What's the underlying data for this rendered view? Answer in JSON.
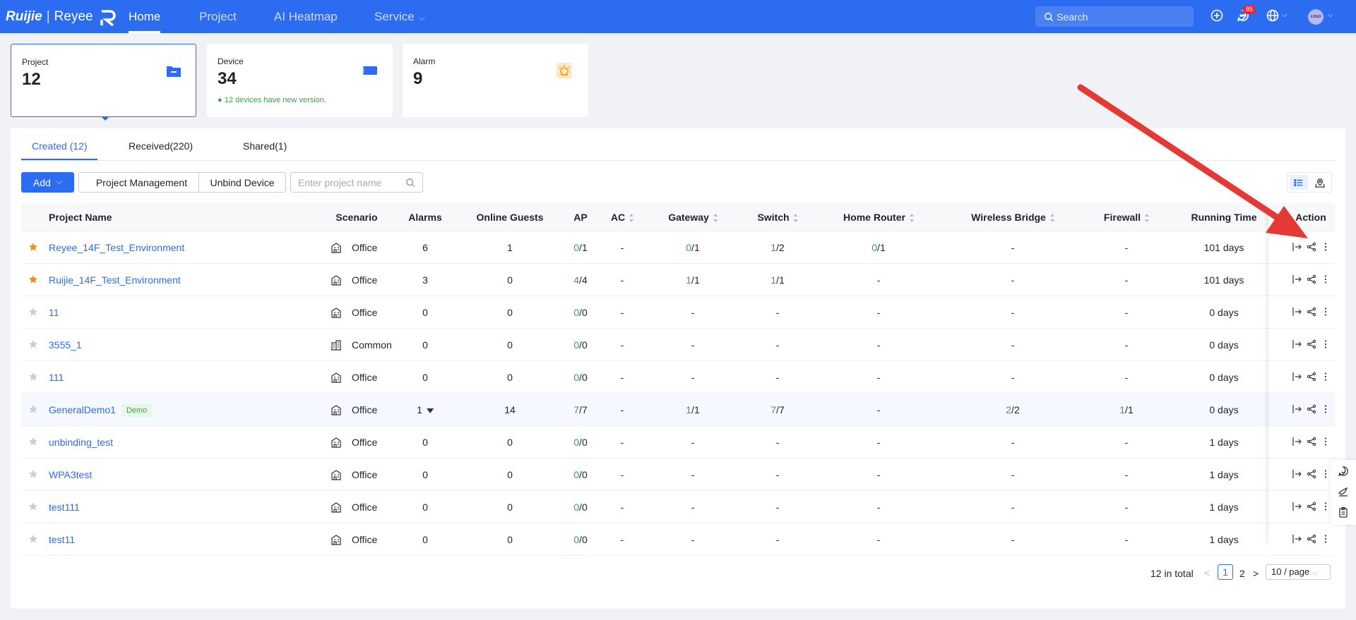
{
  "brand": {
    "name": "Ruijie",
    "sub": "Reyee"
  },
  "nav": {
    "home": "Home",
    "project": "Project",
    "heatmap": "AI Heatmap",
    "service": "Service"
  },
  "search_placeholder": "Search",
  "notifications": {
    "count": "85"
  },
  "avatar": {
    "text": "LOGO"
  },
  "cards": {
    "project": {
      "label": "Project",
      "value": "12"
    },
    "device": {
      "label": "Device",
      "value": "34",
      "note": "12 devices have new version."
    },
    "alarm": {
      "label": "Alarm",
      "value": "9"
    }
  },
  "tabs": {
    "created": "Created (12)",
    "received": "Received(220)",
    "shared": "Shared(1)"
  },
  "toolbar": {
    "add": "Add",
    "project_management": "Project Management",
    "unbind": "Unbind Device",
    "search_placeholder": "Enter project name"
  },
  "columns": {
    "name": "Project Name",
    "scenario": "Scenario",
    "alarms": "Alarms",
    "guests": "Online Guests",
    "ap": "AP",
    "ac": "AC",
    "gateway": "Gateway",
    "switch": "Switch",
    "home_router": "Home Router",
    "bridge": "Wireless Bridge",
    "firewall": "Firewall",
    "running": "Running Time",
    "action": "Action"
  },
  "rows": [
    {
      "name": "Reyee_14F_Test_Environment",
      "starred": true,
      "demo": "",
      "scenario": "Office",
      "alarms": "6",
      "guests": "1",
      "ap_on": "0",
      "ap_tot": "/1",
      "ac": "-",
      "gw_on": "0",
      "gw_tot": "/1",
      "sw_on": "1",
      "sw_tot": "/2",
      "hr_on": "0",
      "hr_tot": "/1",
      "br_on": "",
      "br_tot": "-",
      "fw_on": "",
      "fw_tot": "-",
      "running": "101 days"
    },
    {
      "name": "Ruijie_14F_Test_Environment",
      "starred": true,
      "demo": "",
      "scenario": "Office",
      "alarms": "3",
      "guests": "0",
      "ap_on": "4",
      "ap_tot": "/4",
      "ac": "-",
      "gw_on": "1",
      "gw_tot": "/1",
      "sw_on": "1",
      "sw_tot": "/1",
      "hr_on": "",
      "hr_tot": "-",
      "br_on": "",
      "br_tot": "-",
      "fw_on": "",
      "fw_tot": "-",
      "running": "101 days"
    },
    {
      "name": "11",
      "starred": false,
      "demo": "",
      "scenario": "Office",
      "alarms": "0",
      "guests": "0",
      "ap_on": "0",
      "ap_tot": "/0",
      "ac": "-",
      "gw_on": "",
      "gw_tot": "-",
      "sw_on": "",
      "sw_tot": "-",
      "hr_on": "",
      "hr_tot": "-",
      "br_on": "",
      "br_tot": "-",
      "fw_on": "",
      "fw_tot": "-",
      "running": "0 days"
    },
    {
      "name": "3555_1",
      "starred": false,
      "demo": "",
      "scenario": "Common",
      "alarms": "0",
      "guests": "0",
      "ap_on": "0",
      "ap_tot": "/0",
      "ac": "-",
      "gw_on": "",
      "gw_tot": "-",
      "sw_on": "",
      "sw_tot": "-",
      "hr_on": "",
      "hr_tot": "-",
      "br_on": "",
      "br_tot": "-",
      "fw_on": "",
      "fw_tot": "-",
      "running": "0 days"
    },
    {
      "name": "111",
      "starred": false,
      "demo": "",
      "scenario": "Office",
      "alarms": "0",
      "guests": "0",
      "ap_on": "0",
      "ap_tot": "/0",
      "ac": "-",
      "gw_on": "",
      "gw_tot": "-",
      "sw_on": "",
      "sw_tot": "-",
      "hr_on": "",
      "hr_tot": "-",
      "br_on": "",
      "br_tot": "-",
      "fw_on": "",
      "fw_tot": "-",
      "running": "0 days"
    },
    {
      "name": "GeneralDemo1",
      "starred": false,
      "demo": "Demo",
      "scenario": "Office",
      "alarms": "1",
      "guests": "14",
      "ap_on": "7",
      "ap_tot": "/7",
      "ac": "-",
      "gw_on": "1",
      "gw_tot": "/1",
      "sw_on": "7",
      "sw_tot": "/7",
      "hr_on": "",
      "hr_tot": "-",
      "br_on": "2",
      "br_tot": "/2",
      "fw_on": "1",
      "fw_tot": "/1",
      "running": "0 days"
    },
    {
      "name": "unbinding_test",
      "starred": false,
      "demo": "",
      "scenario": "Office",
      "alarms": "0",
      "guests": "0",
      "ap_on": "0",
      "ap_tot": "/0",
      "ac": "-",
      "gw_on": "",
      "gw_tot": "-",
      "sw_on": "",
      "sw_tot": "-",
      "hr_on": "",
      "hr_tot": "-",
      "br_on": "",
      "br_tot": "-",
      "fw_on": "",
      "fw_tot": "-",
      "running": "1 days"
    },
    {
      "name": "WPA3test",
      "starred": false,
      "demo": "",
      "scenario": "Office",
      "alarms": "0",
      "guests": "0",
      "ap_on": "0",
      "ap_tot": "/0",
      "ac": "-",
      "gw_on": "",
      "gw_tot": "-",
      "sw_on": "",
      "sw_tot": "-",
      "hr_on": "",
      "hr_tot": "-",
      "br_on": "",
      "br_tot": "-",
      "fw_on": "",
      "fw_tot": "-",
      "running": "1 days"
    },
    {
      "name": "test111",
      "starred": false,
      "demo": "",
      "scenario": "Office",
      "alarms": "0",
      "guests": "0",
      "ap_on": "0",
      "ap_tot": "/0",
      "ac": "-",
      "gw_on": "",
      "gw_tot": "-",
      "sw_on": "",
      "sw_tot": "-",
      "hr_on": "",
      "hr_tot": "-",
      "br_on": "",
      "br_tot": "-",
      "fw_on": "",
      "fw_tot": "-",
      "running": "1 days"
    },
    {
      "name": "test11",
      "starred": false,
      "demo": "",
      "scenario": "Office",
      "alarms": "0",
      "guests": "0",
      "ap_on": "0",
      "ap_tot": "/0",
      "ac": "-",
      "gw_on": "",
      "gw_tot": "-",
      "sw_on": "",
      "sw_tot": "-",
      "hr_on": "",
      "hr_tot": "-",
      "br_on": "",
      "br_tot": "-",
      "fw_on": "",
      "fw_tot": "-",
      "running": "1 days"
    }
  ],
  "pagination": {
    "total": "12 in total",
    "prev": "<",
    "page1": "1",
    "page2": "2",
    "next": ">",
    "page_size": "10 / page"
  },
  "colors": {
    "primary": "#2b6cf0",
    "online": "#3aa345",
    "star": "#f08c1a",
    "annotation": "#e53935"
  }
}
